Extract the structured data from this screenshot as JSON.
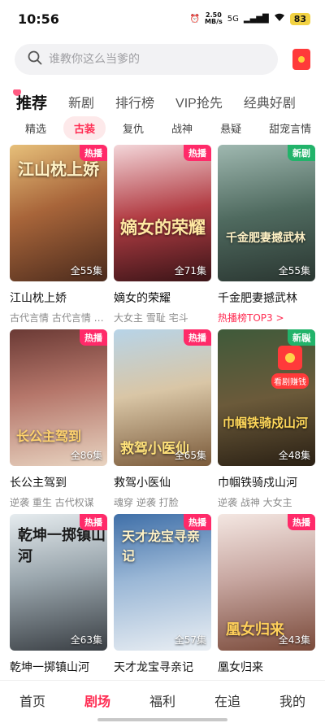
{
  "status_bar": {
    "time": "10:56",
    "net_speed_value": "2.50",
    "net_speed_unit": "MB/s",
    "network": "5G",
    "battery": "83"
  },
  "search": {
    "placeholder": "谁教你这么当爹的"
  },
  "main_tabs": [
    "推荐",
    "新剧",
    "排行榜",
    "VIP抢先",
    "经典好剧"
  ],
  "sub_tabs": [
    "精选",
    "古装",
    "复仇",
    "战神",
    "悬疑",
    "甜宠言情"
  ],
  "floating_ad": {
    "label": "看剧赚钱",
    "close": "✕"
  },
  "dramas": [
    {
      "poster_title": "江山枕上娇",
      "badge": "热播",
      "episodes": "全55集",
      "title": "江山枕上娇",
      "tags": "古代言情 古代言情 …"
    },
    {
      "poster_title": "嫡女的荣耀",
      "badge": "热播",
      "episodes": "全71集",
      "title": "嫡女的荣耀",
      "tags": "大女主 雪耻 宅斗"
    },
    {
      "poster_title": "千金肥妻撼武林",
      "badge": "新剧",
      "episodes": "全55集",
      "title": "千金肥妻撼武林",
      "tags": "热播榜TOP3 >"
    },
    {
      "poster_title": "长公主驾到",
      "badge": "热播",
      "episodes": "全86集",
      "title": "长公主驾到",
      "tags": "逆袭 重生 古代权谋"
    },
    {
      "poster_title": "救驾小医仙",
      "badge": "热播",
      "episodes": "全65集",
      "title": "救驾小医仙",
      "tags": "魂穿 逆袭 打脸"
    },
    {
      "poster_title": "巾帼铁骑戍山河",
      "badge": "新剧",
      "episodes": "全48集",
      "title": "巾帼铁骑戍山河",
      "tags": "逆袭 战神 大女主"
    },
    {
      "poster_title": "乾坤一掷镇山河",
      "badge": "热播",
      "episodes": "全63集",
      "title": "乾坤一掷镇山河",
      "tags": ""
    },
    {
      "poster_title": "天才龙宝寻亲记",
      "badge": "热播",
      "episodes": "全57集",
      "title": "天才龙宝寻亲记",
      "tags": ""
    },
    {
      "poster_title": "凰女归来",
      "badge": "热播",
      "episodes": "全43集",
      "title": "凰女归来",
      "tags": ""
    }
  ],
  "bottom_nav": [
    "首页",
    "剧场",
    "福利",
    "在追",
    "我的"
  ],
  "colors": {
    "accent": "#ff2c52",
    "hot_badge": "#ff2a69",
    "new_badge": "#22b36a"
  }
}
